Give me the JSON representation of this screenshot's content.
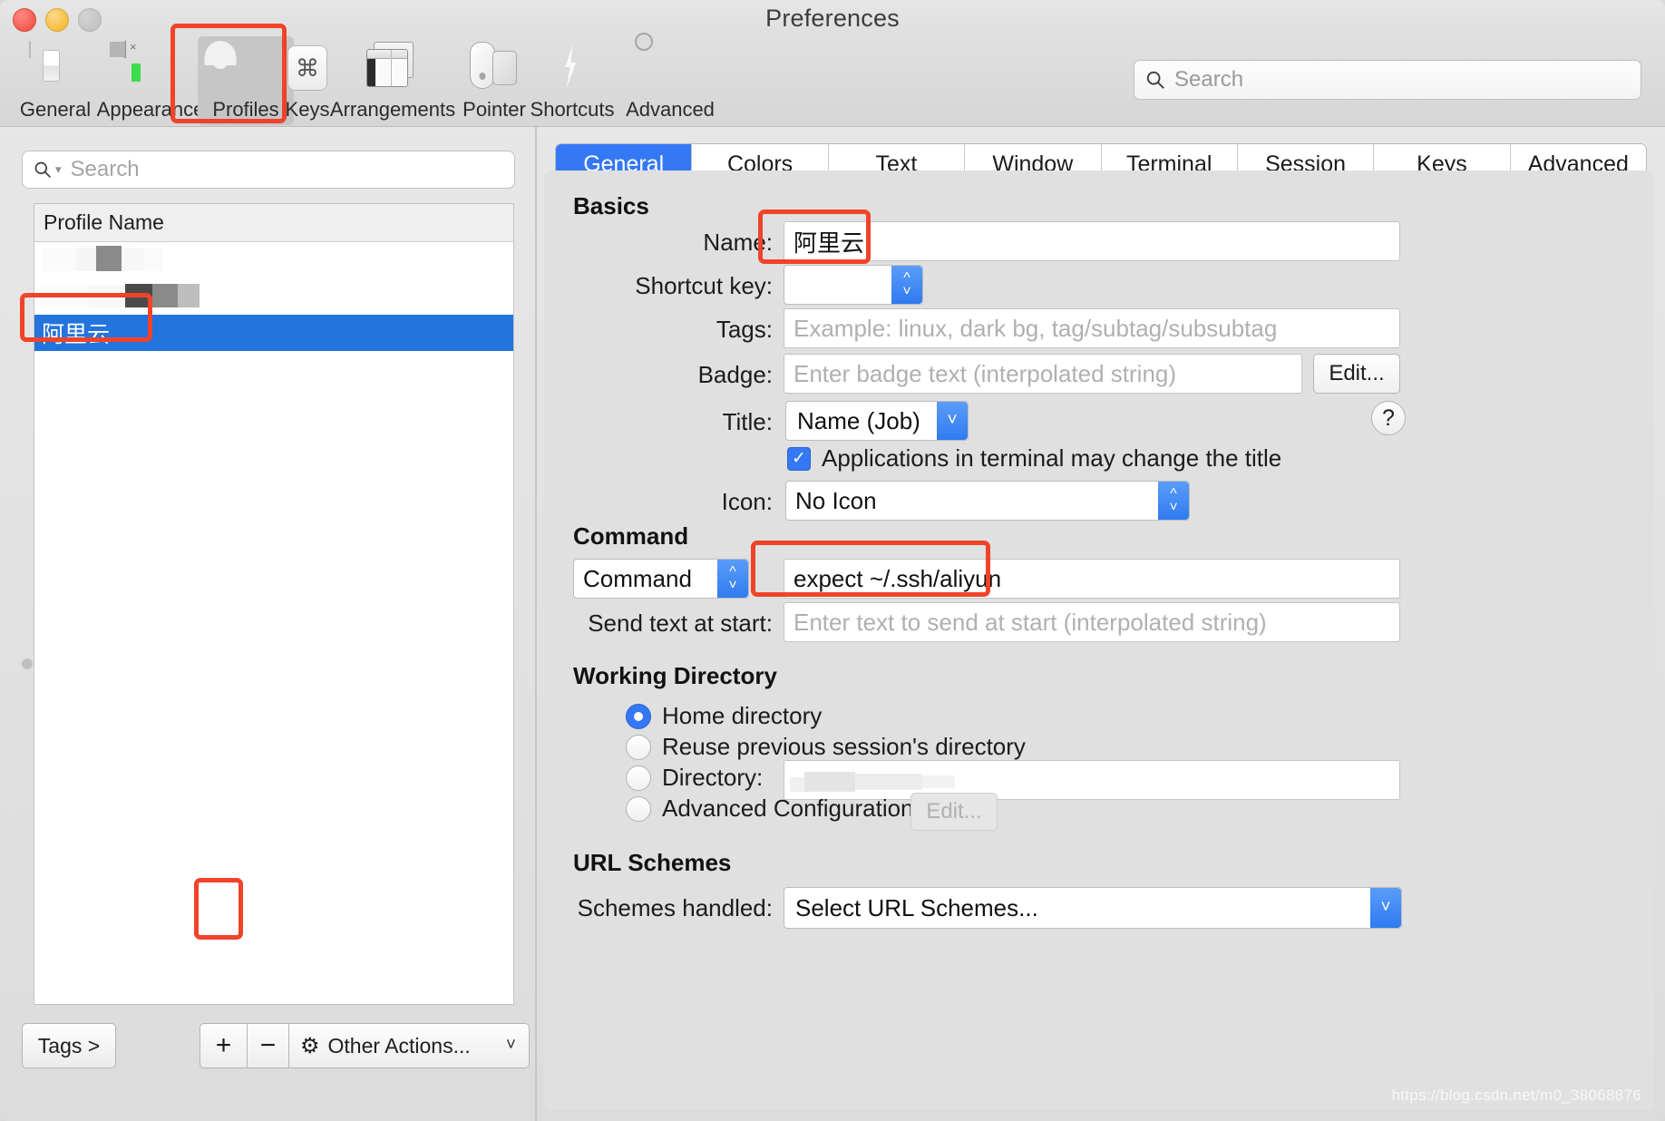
{
  "window": {
    "title": "Preferences",
    "traffic_lights": [
      "close",
      "minimize",
      "zoom"
    ]
  },
  "toolbar": {
    "items": [
      {
        "label": "General",
        "icon": "general-switch-icon",
        "selected": false
      },
      {
        "label": "Appearance",
        "icon": "appearance-terminal-icon",
        "selected": false
      },
      {
        "label": "Profiles",
        "icon": "profiles-person-icon",
        "selected": true
      },
      {
        "label": "Keys",
        "icon": "keys-command-icon",
        "selected": false
      },
      {
        "label": "Arrangements",
        "icon": "arrangements-windows-icon",
        "selected": false
      },
      {
        "label": "Pointer",
        "icon": "pointer-mouse-icon",
        "selected": false
      },
      {
        "label": "Shortcuts",
        "icon": "shortcuts-bolt-icon",
        "selected": false
      },
      {
        "label": "Advanced",
        "icon": "advanced-gear-icon",
        "selected": false
      }
    ],
    "search_placeholder": "Search"
  },
  "sidebar": {
    "search_placeholder": "Search",
    "column_header": "Profile Name",
    "rows": [
      {
        "name": "",
        "redacted": true,
        "selected": false
      },
      {
        "name": "",
        "redacted": true,
        "selected": false
      },
      {
        "name": "阿里云",
        "redacted": false,
        "selected": true
      }
    ],
    "tags_button": "Tags >",
    "add_button": "+",
    "remove_button": "−",
    "other_actions": "Other Actions...",
    "other_actions_icon": "gear-icon",
    "other_actions_caret": "⌄"
  },
  "tabs": [
    {
      "label": "General",
      "active": true
    },
    {
      "label": "Colors",
      "active": false
    },
    {
      "label": "Text",
      "active": false
    },
    {
      "label": "Window",
      "active": false
    },
    {
      "label": "Terminal",
      "active": false
    },
    {
      "label": "Session",
      "active": false
    },
    {
      "label": "Keys",
      "active": false
    },
    {
      "label": "Advanced",
      "active": false
    }
  ],
  "general_tab": {
    "basics": {
      "heading": "Basics",
      "name_label": "Name:",
      "name_value": "阿里云",
      "shortcut_label": "Shortcut key:",
      "shortcut_value": "",
      "tags_label": "Tags:",
      "tags_placeholder": "Example: linux, dark bg, tag/subtag/subsubtag",
      "badge_label": "Badge:",
      "badge_placeholder": "Enter badge text (interpolated string)",
      "badge_edit_button": "Edit...",
      "title_label": "Title:",
      "title_value": "Name (Job)",
      "help_button": "?",
      "title_checkbox_label": "Applications in terminal may change the title",
      "title_checkbox_checked": true,
      "icon_label": "Icon:",
      "icon_value": "No Icon"
    },
    "command": {
      "heading": "Command",
      "mode_value": "Command",
      "command_value": "expect ~/.ssh/aliyun",
      "send_text_label": "Send text at start:",
      "send_text_placeholder": "Enter text to send at start (interpolated string)"
    },
    "working_directory": {
      "heading": "Working Directory",
      "options": [
        {
          "label": "Home directory",
          "selected": true
        },
        {
          "label": "Reuse previous session's directory",
          "selected": false
        },
        {
          "label": "Directory:",
          "selected": false
        },
        {
          "label": "Advanced Configuration",
          "selected": false
        }
      ],
      "directory_value": "",
      "advanced_edit_button": "Edit...",
      "advanced_edit_disabled": true
    },
    "url_schemes": {
      "heading": "URL Schemes",
      "schemes_label": "Schemes handled:",
      "schemes_value": "Select URL Schemes..."
    }
  },
  "annotations": {
    "color": "#F0432A",
    "highlights": [
      "profiles-toolbar-item",
      "selected-profile-row",
      "name-field-value",
      "command-field-value",
      "add-profile-button"
    ]
  },
  "watermark": "https://blog.csdn.net/m0_38068876"
}
